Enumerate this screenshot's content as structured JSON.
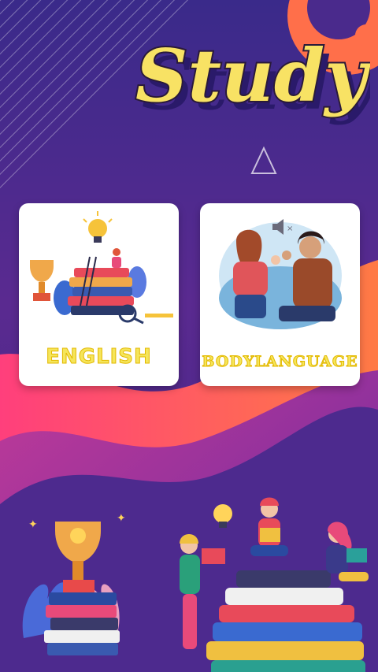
{
  "app": {
    "title": "Study"
  },
  "cards": [
    {
      "label": "ENGLISH",
      "icon": "english-learning-illustration"
    },
    {
      "label": "BODYLANGUAGE",
      "icon": "body-language-illustration"
    }
  ],
  "colors": {
    "background": "#4a2a8c",
    "accent_pink": "#ff4d7a",
    "accent_orange": "#ff7a45",
    "title_yellow": "#f8e264",
    "label_yellow": "#f5e55a"
  }
}
